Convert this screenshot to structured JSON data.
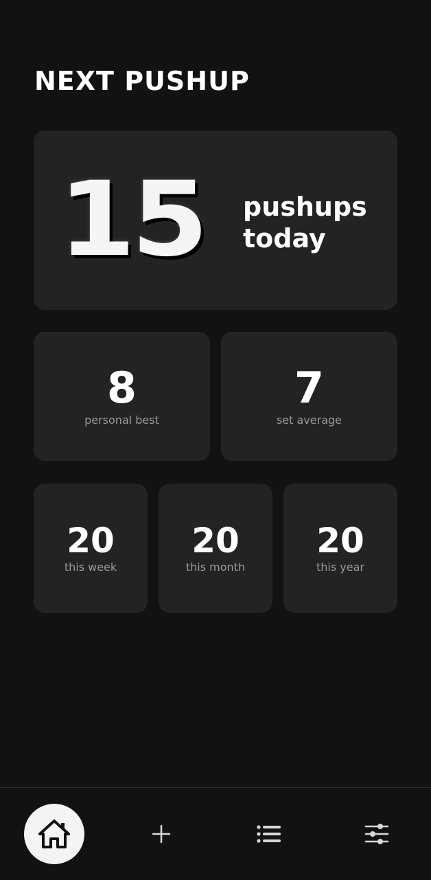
{
  "header": {
    "title": "NEXT PUSHUP"
  },
  "today": {
    "count": "15",
    "label_line1": "pushups",
    "label_line2": "today"
  },
  "stats_primary": [
    {
      "value": "8",
      "label": "personal best"
    },
    {
      "value": "7",
      "label": "set average"
    }
  ],
  "stats_period": [
    {
      "value": "20",
      "label": "this week"
    },
    {
      "value": "20",
      "label": "this month"
    },
    {
      "value": "20",
      "label": "this year"
    }
  ],
  "bottom_nav": {
    "active": "home",
    "items": [
      {
        "key": "home",
        "icon": "home-icon"
      },
      {
        "key": "add",
        "icon": "plus-icon"
      },
      {
        "key": "list",
        "icon": "list-icon"
      },
      {
        "key": "settings",
        "icon": "sliders-icon"
      }
    ]
  },
  "colors": {
    "background": "#121212",
    "card": "#232323",
    "text": "#ffffff",
    "muted": "#9a9a9a",
    "nav_active": "#f4f4f4"
  }
}
